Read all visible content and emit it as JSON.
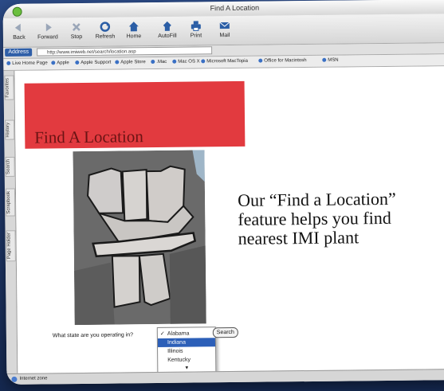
{
  "window": {
    "title": "Find A Location",
    "traffic_color": "#6bbf3e"
  },
  "toolbar": {
    "buttons": [
      {
        "label": "Back",
        "icon": "back-arrow-icon"
      },
      {
        "label": "Forward",
        "icon": "forward-arrow-icon"
      },
      {
        "label": "Stop",
        "icon": "stop-icon"
      },
      {
        "label": "Refresh",
        "icon": "refresh-icon"
      },
      {
        "label": "Home",
        "icon": "home-icon"
      },
      {
        "label": "AutoFill",
        "icon": "autofill-icon"
      },
      {
        "label": "Print",
        "icon": "printer-icon"
      },
      {
        "label": "Mail",
        "icon": "mail-icon"
      }
    ]
  },
  "address": {
    "label": "Address",
    "url": "http://www.imiweb.net/search/location.asp"
  },
  "favorites": {
    "items": [
      "Live Home Page",
      "Apple",
      "Apple Support",
      "Apple Store",
      ".Mac",
      "Mac OS X",
      "Microsoft MacTopia",
      "Office for Macintosh",
      "MSN"
    ]
  },
  "sidebar": {
    "tabs": [
      "Favorites",
      "History",
      "Search",
      "Scrapbook",
      "Page Holder"
    ]
  },
  "page": {
    "banner_title": "Find A Location",
    "banner_color": "#e23a3f",
    "tagline_lines": [
      "Our “Find a Location”",
      "feature helps you find",
      "nearest IMI plant"
    ],
    "question": "What state are you operating in?",
    "search_label": "Search"
  },
  "state_select": {
    "options": [
      "Alabama",
      "Indiana",
      "Illinois",
      "Kentucky"
    ],
    "checked": "Alabama",
    "highlighted": "Indiana",
    "more_indicator": "▼"
  },
  "status": {
    "text": "Internet zone"
  }
}
